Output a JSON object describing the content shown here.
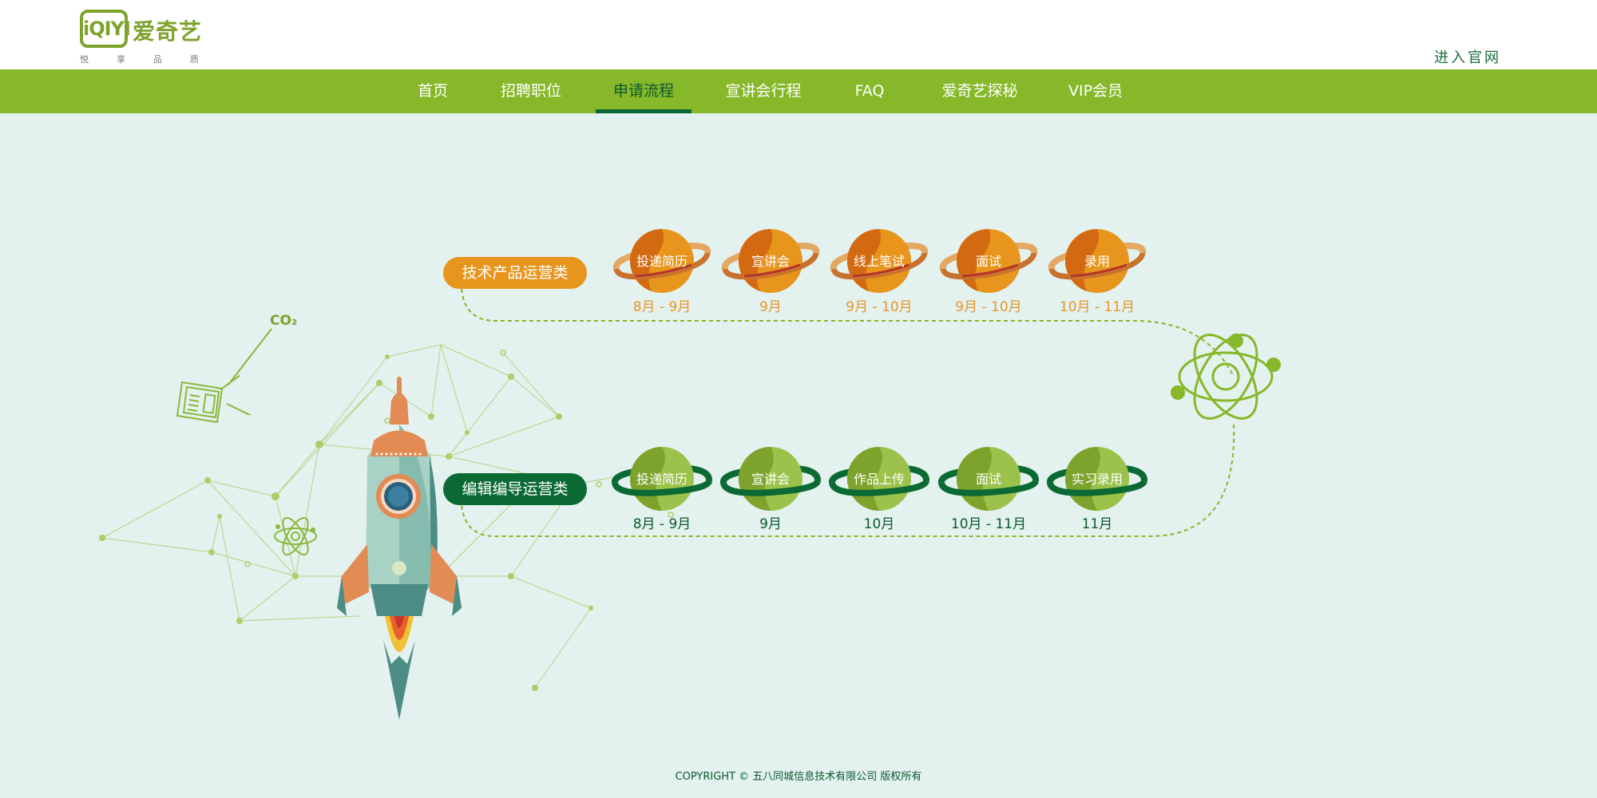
{
  "brand": {
    "logo_mark": "iQIYI",
    "logo_text": "爱奇艺",
    "slogan": "悦享品质"
  },
  "header": {
    "enter_site": "进入官网"
  },
  "nav": {
    "items": [
      "首页",
      "招聘职位",
      "申请流程",
      "宣讲会行程",
      "FAQ",
      "爱奇艺探秘",
      "VIP会员"
    ],
    "active_index": 2
  },
  "tracks": [
    {
      "label": "技术产品运营类",
      "color": "#e8951d",
      "stages": [
        {
          "name": "投递简历",
          "date": "8月 - 9月"
        },
        {
          "name": "宣讲会",
          "date": "9月"
        },
        {
          "name": "线上笔试",
          "date": "9月 - 10月"
        },
        {
          "name": "面试",
          "date": "9月 - 10月"
        },
        {
          "name": "录用",
          "date": "10月 - 11月"
        }
      ]
    },
    {
      "label": "编辑编导运营类",
      "color": "#0b6a33",
      "stages": [
        {
          "name": "投递简历",
          "date": "8月 - 9月"
        },
        {
          "name": "宣讲会",
          "date": "9月"
        },
        {
          "name": "作品上传",
          "date": "10月"
        },
        {
          "name": "面试",
          "date": "10月 - 11月"
        },
        {
          "name": "实习录用",
          "date": "11月"
        }
      ]
    }
  ],
  "decor": {
    "co2": "CO₂",
    "icons": [
      "rocket-icon",
      "atom-icon",
      "calculator-icon",
      "network-icon"
    ]
  },
  "colors": {
    "nav_green": "#86b829",
    "dark_green": "#0b6a33",
    "orange": "#e8951d",
    "background": "#e3f1ef"
  },
  "footer": {
    "copyright": "COPYRIGHT © 五八同城信息技术有限公司 版权所有"
  }
}
